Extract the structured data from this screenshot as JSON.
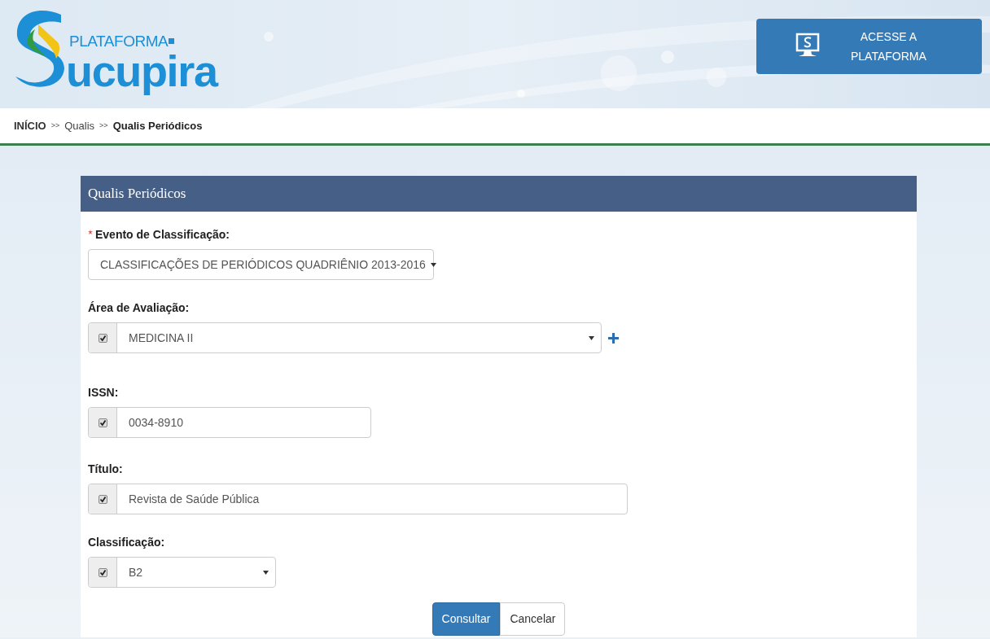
{
  "header": {
    "logo": {
      "small": "PLATAFORMA",
      "large": "ucupira"
    },
    "access_button": {
      "line_1": "ACESSE A",
      "line_2": "PLATAFORMA"
    }
  },
  "breadcrumb": [
    {
      "label": "INÍCIO",
      "kind": "link"
    },
    {
      "label": "Qualis",
      "kind": "link"
    },
    {
      "label": "Qualis Periódicos",
      "kind": "current"
    }
  ],
  "breadcrumb_separator": ">>",
  "panel": {
    "title": "Qualis Periódicos",
    "fields": [
      {
        "label": "Evento de Classificação:",
        "required": true,
        "kind": "select",
        "value": "CLASSIFICAÇÕES DE PERIÓDICOS QUADRIÊNIO 2013-2016"
      },
      {
        "label": "Área de Avaliação:",
        "kind": "select",
        "checked": true,
        "value": "MEDICINA II",
        "addable": true
      },
      {
        "label": "ISSN:",
        "kind": "input",
        "checked": true,
        "value": "0034-8910"
      },
      {
        "label": "Título:",
        "kind": "input",
        "checked": true,
        "value": "Revista de Saúde Pública"
      },
      {
        "label": "Classificação:",
        "kind": "select",
        "checked": true,
        "value": "B2"
      }
    ],
    "buttons": [
      {
        "label": "Consultar",
        "kind": "primary"
      },
      {
        "label": "Cancelar",
        "kind": "default"
      }
    ]
  }
}
